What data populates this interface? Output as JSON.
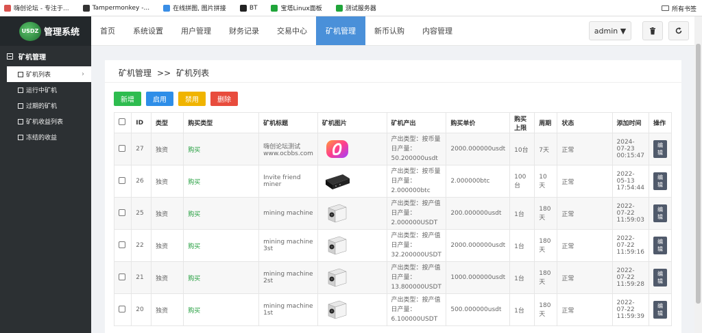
{
  "bookmarks": [
    {
      "label": "嗨创论坛 - 专注于...",
      "color": "#d9534f"
    },
    {
      "label": "Tampermonkey -...",
      "color": "#333333"
    },
    {
      "label": "在线拼图, 图片拼接",
      "color": "#3a8ee6"
    },
    {
      "label": "BT",
      "color": "#222222"
    },
    {
      "label": "宝塔Linux面板",
      "color": "#20a53a"
    },
    {
      "label": "测试服务器",
      "color": "#20a53a"
    }
  ],
  "bookmarks_right": "所有书签",
  "logo": {
    "badge": "USDZ",
    "title": "管理系统"
  },
  "sidebar": {
    "heading": "矿机管理",
    "items": [
      {
        "label": "矿机列表",
        "active": true
      },
      {
        "label": "运行中矿机"
      },
      {
        "label": "过期的矿机"
      },
      {
        "label": "矿机收益列表"
      },
      {
        "label": "冻结的收益"
      }
    ]
  },
  "nav": {
    "items": [
      "首页",
      "系统设置",
      "用户管理",
      "财务记录",
      "交易中心",
      "矿机管理",
      "新币认购",
      "内容管理"
    ],
    "active_index": 5,
    "admin_label": "admin ▼"
  },
  "breadcrumb": {
    "parent": "矿机管理",
    "sep": ">>",
    "current": "矿机列表"
  },
  "actions": [
    {
      "label": "新增",
      "color": "#2ebc4f"
    },
    {
      "label": "启用",
      "color": "#2e8ee8"
    },
    {
      "label": "禁用",
      "color": "#f0b400"
    },
    {
      "label": "删除",
      "color": "#e84c3d"
    }
  ],
  "table": {
    "headers": [
      "ID",
      "类型",
      "购买类型",
      "矿机标题",
      "矿机图片",
      "矿机产出",
      "购买单价",
      "购买上限",
      "周期",
      "状态",
      "添加时间",
      "操作"
    ],
    "edit_label": "编辑",
    "rows": [
      {
        "id": "27",
        "type": "独资",
        "buy_type": "购买",
        "title": "嗨创论坛测试 www.ocbbs.com",
        "image": "logo",
        "out_type": "产出类型：按币量",
        "daily": "日产量：50.200000usdt",
        "price": "2000.000000usdt",
        "limit": "10台",
        "period": "7天",
        "status": "正常",
        "time": "2024-07-23 00:15:47"
      },
      {
        "id": "26",
        "type": "独资",
        "buy_type": "购买",
        "title": "Invite friend miner",
        "image": "box",
        "out_type": "产出类型：按币量",
        "daily": "日产量：2.000000btc",
        "price": "2.000000btc",
        "limit": "100台",
        "period": "10天",
        "status": "正常",
        "time": "2022-05-13 17:54:44"
      },
      {
        "id": "25",
        "type": "独资",
        "buy_type": "购买",
        "title": "mining machine",
        "image": "miner",
        "out_type": "产出类型：按产值",
        "daily": "日产量：2.000000USDT",
        "price": "200.000000usdt",
        "limit": "1台",
        "period": "180天",
        "status": "正常",
        "time": "2022-07-22 11:59:03"
      },
      {
        "id": "22",
        "type": "独资",
        "buy_type": "购买",
        "title": "mining machine 3st",
        "image": "miner",
        "out_type": "产出类型：按产值",
        "daily": "日产量：32.200000USDT",
        "price": "2000.000000usdt",
        "limit": "1台",
        "period": "180天",
        "status": "正常",
        "time": "2022-07-22 11:59:16"
      },
      {
        "id": "21",
        "type": "独资",
        "buy_type": "购买",
        "title": "mining machine 2st",
        "image": "miner",
        "out_type": "产出类型：按产值",
        "daily": "日产量：13.800000USDT",
        "price": "1000.000000usdt",
        "limit": "1台",
        "period": "180天",
        "status": "正常",
        "time": "2022-07-22 11:59:28"
      },
      {
        "id": "20",
        "type": "独资",
        "buy_type": "购买",
        "title": "mining machine 1st",
        "image": "miner",
        "out_type": "产出类型：按产值",
        "daily": "日产量：6.100000USDT",
        "price": "500.000000usdt",
        "limit": "1台",
        "period": "180天",
        "status": "正常",
        "time": "2022-07-22 11:59:39"
      }
    ]
  }
}
